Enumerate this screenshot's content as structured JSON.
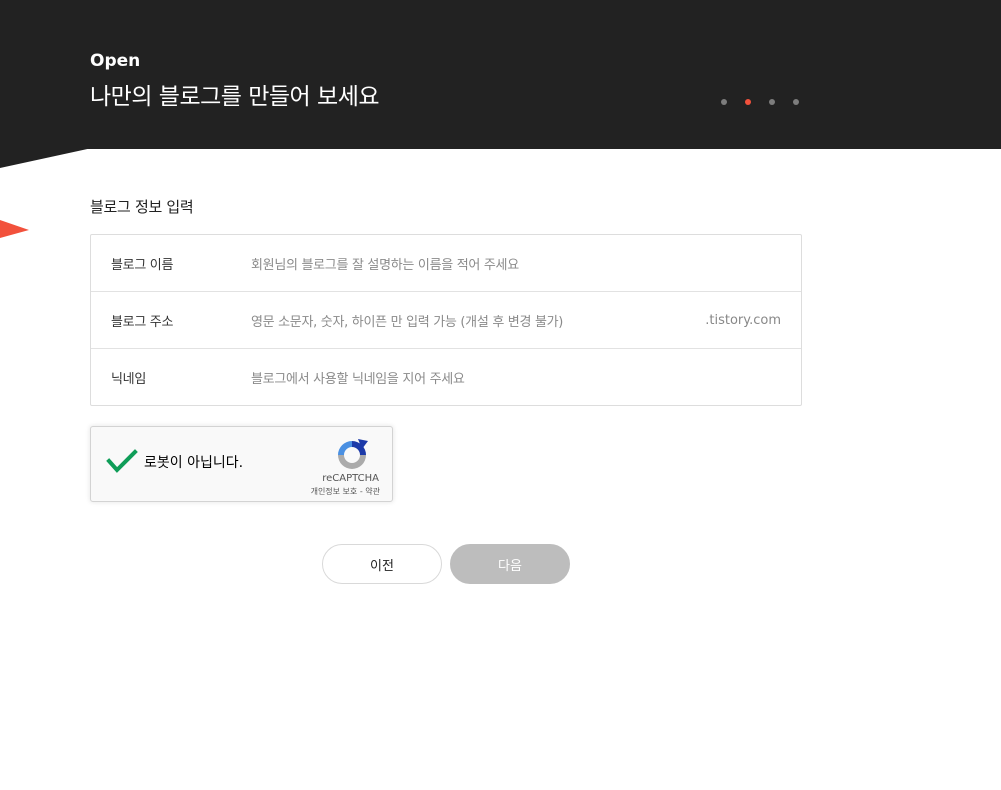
{
  "header": {
    "label": "Open",
    "title": "나만의 블로그를 만들어 보세요",
    "steps": 4,
    "active_step": 1,
    "background": "#222222",
    "accent": "#f2513c"
  },
  "form": {
    "section_title": "블로그 정보 입력",
    "rows": [
      {
        "label": "블로그 이름",
        "placeholder": "회원님의 블로그를 잘 설명하는 이름을 적어 주세요",
        "suffix": ""
      },
      {
        "label": "블로그 주소",
        "placeholder": "영문 소문자, 숫자, 하이픈 만 입력 가능 (개설 후 변경 불가)",
        "suffix": ".tistory.com"
      },
      {
        "label": "닉네임",
        "placeholder": "블로그에서 사용할 닉네임을 지어 주세요",
        "suffix": ""
      }
    ]
  },
  "recaptcha": {
    "label": "로봇이 아닙니다.",
    "brand": "reCAPTCHA",
    "privacy": "개인정보 보호",
    "separator": " - ",
    "terms": "약관",
    "checked": true
  },
  "buttons": {
    "prev": "이전",
    "next": "다음"
  }
}
